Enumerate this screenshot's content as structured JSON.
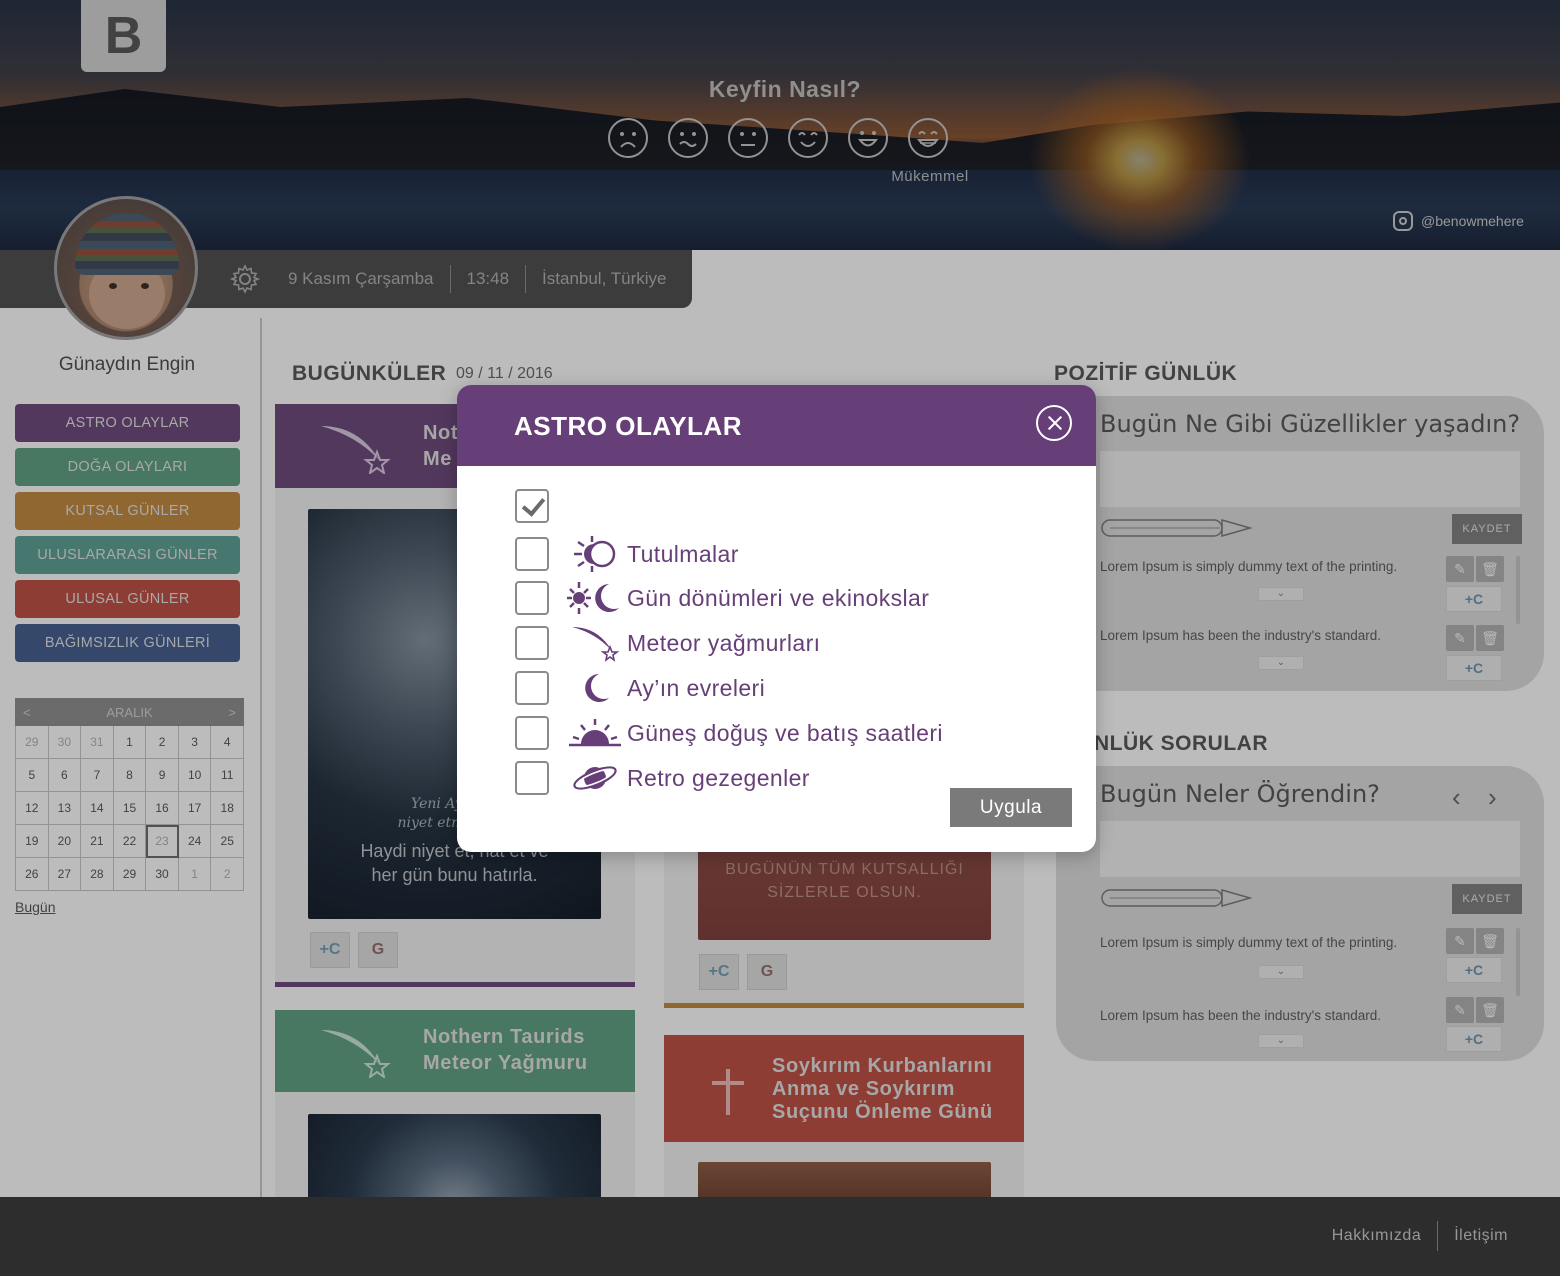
{
  "header": {
    "logo": "B",
    "mood_title": "Keyfin Nasıl?",
    "mood_caption": "Mükemmel",
    "moods": [
      "very-sad-face-icon",
      "sad-face-icon",
      "neutral-face-icon",
      "smile-face-icon",
      "happy-face-icon",
      "grin-face-icon"
    ],
    "instagram": "@benowmehere"
  },
  "infobar": {
    "date": "9 Kasım Çarşamba",
    "time": "13:48",
    "location": "İstanbul, Türkiye"
  },
  "user": {
    "greeting": "Günaydın Engin"
  },
  "sidebar": {
    "categories": [
      {
        "label": "ASTRO OLAYLAR",
        "color": "#6b4878"
      },
      {
        "label": "DOĞA OLAYLARI",
        "color": "#5e9a7e"
      },
      {
        "label": "KUTSAL GÜNLER",
        "color": "#b9853e"
      },
      {
        "label": "ULUSLARARASI GÜNLER",
        "color": "#5b9a90"
      },
      {
        "label": "ULUSAL GÜNLER",
        "color": "#b64f44"
      },
      {
        "label": "BAĞIMSIZLIK GÜNLERİ",
        "color": "#445c8a"
      }
    ],
    "calendar": {
      "month": "ARALIK",
      "prev": "<",
      "next": ">",
      "days": [
        [
          "29",
          "30",
          "31",
          "1",
          "2",
          "3",
          "4"
        ],
        [
          "5",
          "6",
          "7",
          "8",
          "9",
          "10",
          "11"
        ],
        [
          "12",
          "13",
          "14",
          "15",
          "16",
          "17",
          "18"
        ],
        [
          "19",
          "20",
          "21",
          "22",
          "23",
          "24",
          "25"
        ],
        [
          "26",
          "27",
          "28",
          "29",
          "30",
          "1",
          "2"
        ]
      ]
    },
    "today_link": "Bugün"
  },
  "main": {
    "title": "BUGÜNKÜLER",
    "date": "09 / 11 / 2016",
    "cards": [
      {
        "title_line1": "Not",
        "title_line2": "Me"
      },
      {
        "poster_line1": "BUGÜNÜN TÜM KUTSALLIĞI",
        "poster_line2": "SİZLERLE OLSUN."
      },
      {
        "title_line1": "Nothern Taurids",
        "title_line2": "Meteor Yağmuru"
      },
      {
        "title_line1": "Soykırım Kurbanlarını",
        "title_line2": "Anma ve Soykırım",
        "title_line3": "Suçunu Önleme Günü"
      }
    ],
    "poster1": {
      "script1": "Yeni Ay geni",
      "script2": "niyet etmek için",
      "line1": "Haydi niyet et, hat et ve",
      "line2": "her gün bunu hatırla."
    },
    "share_add": "+C",
    "share_google": "G"
  },
  "right": {
    "pozitif": {
      "title": "POZİTİF GÜNLÜK",
      "question": "Bugün Ne Gibi Güzellikler yaşadın?",
      "save": "KAYDET",
      "entries": [
        "Lorem Ipsum is simply dummy text of the printing.",
        "Lorem Ipsum has been the industry's standard."
      ]
    },
    "sorular": {
      "title": "NLÜK SORULAR",
      "question": "Bugün Neler Öğrendin?",
      "save": "KAYDET",
      "entries": [
        "Lorem Ipsum is simply dummy text of the printing.",
        "Lorem Ipsum has been the industry's standard."
      ]
    }
  },
  "footer": {
    "about": "Hakkımızda",
    "contact": "İletişim"
  },
  "modal": {
    "title": "ASTRO OLAYLAR",
    "options": [
      {
        "label": "Tutulmalar",
        "icon": "eclipse-icon"
      },
      {
        "label": "Gün dönümleri ve ekinokslar",
        "icon": "sun-moon-icon"
      },
      {
        "label": "Meteor yağmurları",
        "icon": "meteor-icon"
      },
      {
        "label": "Ay’ın evreleri",
        "icon": "moon-icon"
      },
      {
        "label": "Güneş doğuş ve batış saatleri",
        "icon": "sunrise-icon"
      },
      {
        "label": "Retro gezegenler",
        "icon": "planet-icon"
      }
    ],
    "apply": "Uygula",
    "accent": "#673f78"
  }
}
